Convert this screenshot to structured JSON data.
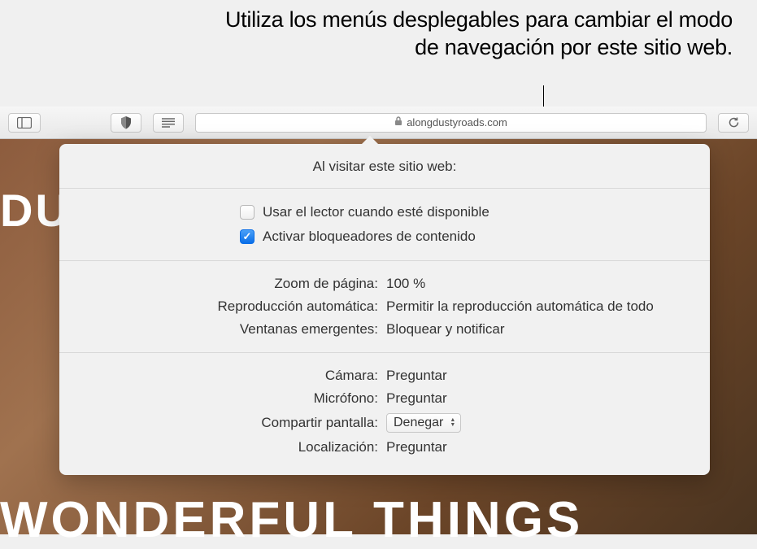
{
  "annotation": "Utiliza los menús desplegables para cambiar el modo de navegación por este sitio web.",
  "toolbar": {
    "url": "alongdustyroads.com"
  },
  "background": {
    "top_fragment": "DU",
    "bottom_fragment": "WONDERFUL THINGS"
  },
  "popover": {
    "header": "Al visitar este sitio web:",
    "reader_checkbox": "Usar el lector cuando esté disponible",
    "reader_checked": false,
    "blocker_checkbox": "Activar bloqueadores de contenido",
    "blocker_checked": true,
    "rows": {
      "zoom": {
        "label": "Zoom de página:",
        "value": "100 %"
      },
      "autoplay": {
        "label": "Reproducción automática:",
        "value": "Permitir la reproducción automática de todo"
      },
      "popups": {
        "label": "Ventanas emergentes:",
        "value": "Bloquear y notificar"
      },
      "camera": {
        "label": "Cámara:",
        "value": "Preguntar"
      },
      "mic": {
        "label": "Micrófono:",
        "value": "Preguntar"
      },
      "screen": {
        "label": "Compartir pantalla:",
        "value": "Denegar"
      },
      "location": {
        "label": "Localización:",
        "value": "Preguntar"
      }
    }
  }
}
